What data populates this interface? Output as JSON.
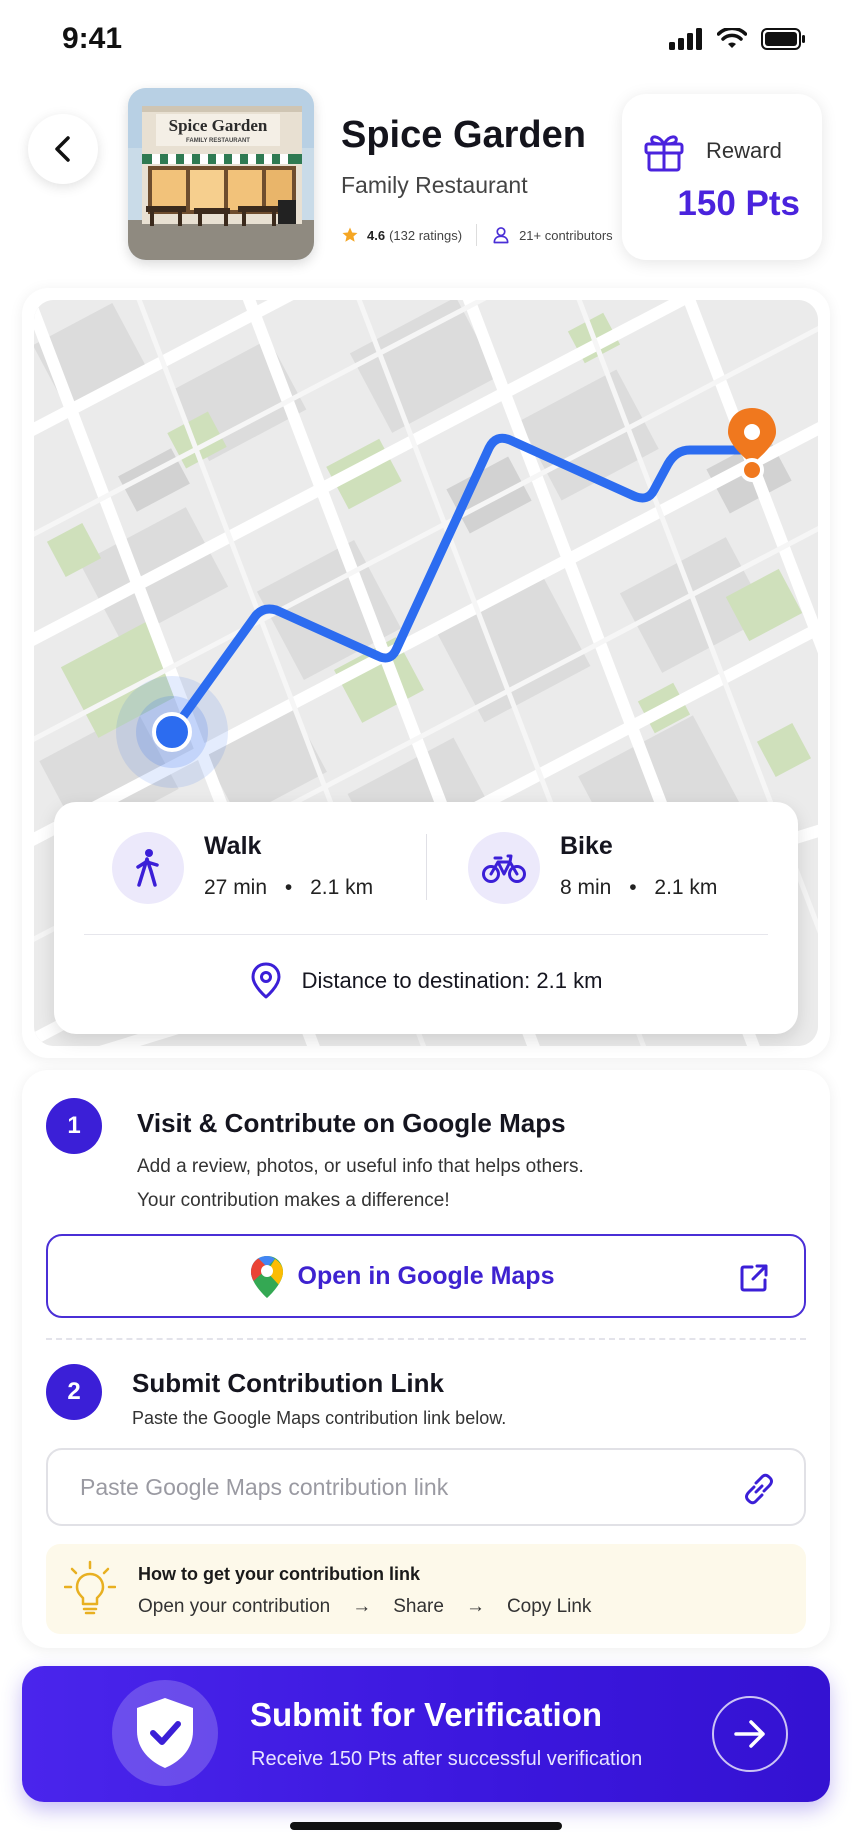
{
  "status_bar": {
    "time": "9:41"
  },
  "header": {
    "title": "Spice Garden",
    "subtitle": "Family Restaurant",
    "storefront_sign": "Spice Garden",
    "storefront_sign_sub": "FAMILY RESTAURANT",
    "rating": "4.6",
    "ratings_count": "(132 ratings)",
    "contributors": "21+ contributors"
  },
  "reward": {
    "label": "Reward",
    "value": "150 Pts"
  },
  "route": {
    "walk": {
      "label": "Walk",
      "time": "27 min",
      "distance": "2.1 km"
    },
    "bike": {
      "label": "Bike",
      "time": "8 min",
      "distance": "2.1 km"
    },
    "distance_text": "Distance to destination: 2.1 km"
  },
  "steps": [
    {
      "number": "1",
      "title": "Visit & Contribute on Google Maps",
      "desc_line1": "Add a review, photos, or useful info that helps others.",
      "desc_line2": "Your contribution makes a difference!",
      "button_label": "Open in Google Maps"
    },
    {
      "number": "2",
      "title": "Submit Contribution Link",
      "desc": "Paste the Google Maps contribution link below.",
      "input_placeholder": "Paste Google Maps contribution link"
    }
  ],
  "tip": {
    "title": "How to get your contribution link",
    "steps": [
      "Open your contribution",
      "Share",
      "Copy Link"
    ],
    "arrow": "→"
  },
  "submit": {
    "title": "Submit for Verification",
    "subtitle": "Receive 150 Pts after successful verification"
  },
  "colors": {
    "accent": "#3b1fd7",
    "route": "#2c6cf0",
    "destination": "#f0781e",
    "star": "#f5a623",
    "tip_background": "#fdf9ea"
  }
}
